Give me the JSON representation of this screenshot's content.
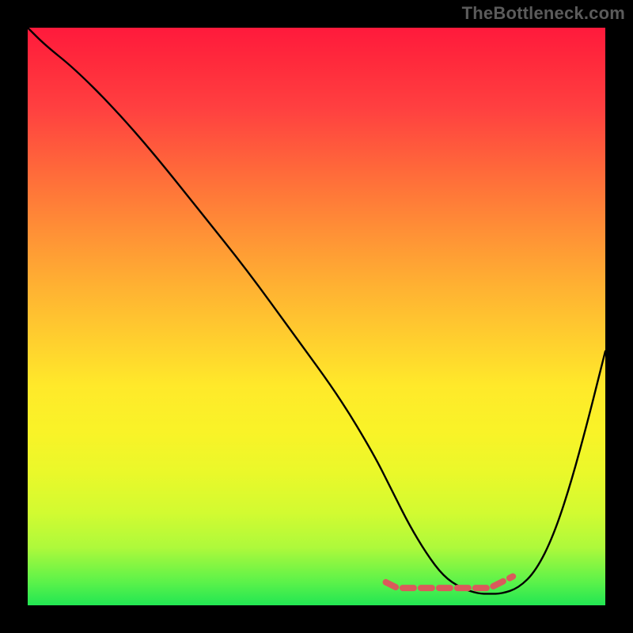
{
  "watermark": "TheBottleneck.com",
  "chart_data": {
    "type": "line",
    "title": "",
    "xlabel": "",
    "ylabel": "",
    "xlim": [
      0,
      100
    ],
    "ylim": [
      0,
      100
    ],
    "series": [
      {
        "name": "black-curve",
        "color": "#000000",
        "x": [
          0,
          3,
          8,
          15,
          22,
          30,
          38,
          46,
          54,
          60,
          63,
          66,
          69,
          72,
          75,
          78,
          80,
          82,
          85,
          88,
          91,
          94,
          97,
          100
        ],
        "values": [
          100,
          97,
          93,
          86,
          78,
          68,
          58,
          47,
          36,
          26,
          20,
          14,
          9,
          5,
          3,
          2,
          2,
          2,
          3,
          6,
          12,
          21,
          32,
          44
        ]
      },
      {
        "name": "red-marker-band",
        "color": "#e06666",
        "x": [
          62,
          64,
          66,
          68,
          70,
          72,
          74,
          76,
          78,
          80,
          82,
          84
        ],
        "values": [
          4,
          3,
          3,
          3,
          3,
          3,
          3,
          3,
          3,
          3,
          4,
          5
        ]
      }
    ],
    "background_gradient": {
      "direction": "vertical",
      "stops": [
        {
          "pos": 0,
          "color": "#ff1a3c"
        },
        {
          "pos": 25,
          "color": "#ff6a3a"
        },
        {
          "pos": 55,
          "color": "#ffd22e"
        },
        {
          "pos": 77,
          "color": "#eaf82a"
        },
        {
          "pos": 100,
          "color": "#22e653"
        }
      ]
    }
  }
}
